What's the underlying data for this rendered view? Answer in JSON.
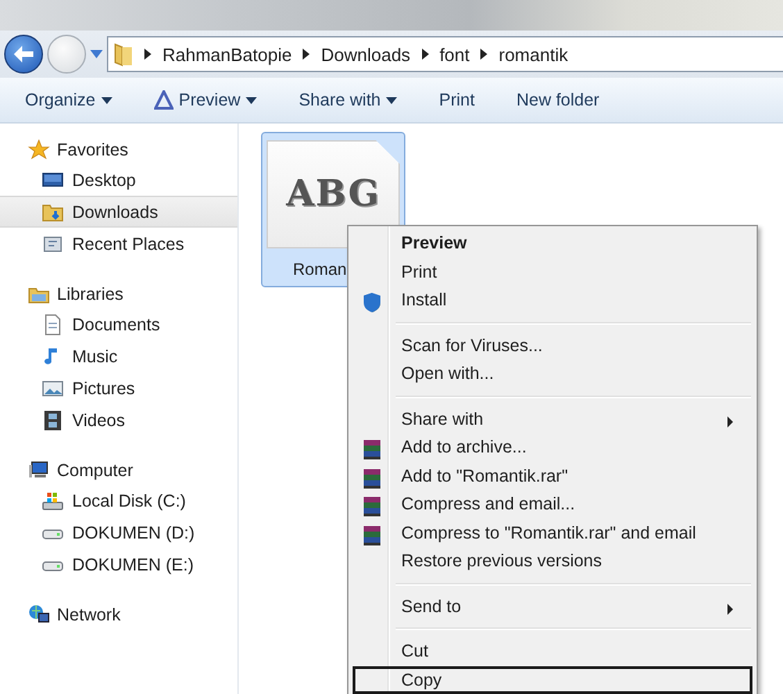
{
  "address_bar": {
    "path": [
      "RahmanBatopie",
      "Downloads",
      "font",
      "romantik"
    ]
  },
  "toolbar": [
    {
      "label": "Organize",
      "dropdown": true,
      "kind": "plain"
    },
    {
      "label": "Preview",
      "dropdown": true,
      "kind": "preview"
    },
    {
      "label": "Share with",
      "dropdown": true,
      "kind": "plain"
    },
    {
      "label": "Print",
      "dropdown": false,
      "kind": "plain"
    },
    {
      "label": "New folder",
      "dropdown": false,
      "kind": "plain"
    }
  ],
  "sidebar": {
    "groups": [
      {
        "label": "Favorites",
        "kind": "star",
        "items": [
          {
            "label": "Desktop",
            "kind": "desktop",
            "selected": false
          },
          {
            "label": "Downloads",
            "kind": "downloads",
            "selected": true
          },
          {
            "label": "Recent Places",
            "kind": "recent",
            "selected": false
          }
        ]
      },
      {
        "label": "Libraries",
        "kind": "libraries",
        "items": [
          {
            "label": "Documents",
            "kind": "document",
            "selected": false
          },
          {
            "label": "Music",
            "kind": "music",
            "selected": false
          },
          {
            "label": "Pictures",
            "kind": "pictures",
            "selected": false
          },
          {
            "label": "Videos",
            "kind": "videos",
            "selected": false
          }
        ]
      },
      {
        "label": "Computer",
        "kind": "computer",
        "items": [
          {
            "label": "Local Disk (C:)",
            "kind": "system-disk",
            "selected": false
          },
          {
            "label": "DOKUMEN (D:)",
            "kind": "drive",
            "selected": false
          },
          {
            "label": "DOKUMEN (E:)",
            "kind": "drive",
            "selected": false
          }
        ]
      },
      {
        "label": "Network",
        "kind": "network"
      }
    ]
  },
  "files": [
    {
      "name": "Roman",
      "thumbnail_text": "ABG",
      "selected": true
    }
  ],
  "context_menu": {
    "groups": [
      [
        {
          "label": "Preview",
          "kind": "plain",
          "default": true,
          "submenu": false,
          "focused": false
        },
        {
          "label": "Print",
          "kind": "plain",
          "default": false,
          "submenu": false,
          "focused": false
        },
        {
          "label": "Install",
          "kind": "shield",
          "default": false,
          "submenu": false,
          "focused": false
        }
      ],
      [
        {
          "label": "Scan for Viruses...",
          "kind": "plain",
          "default": false,
          "submenu": false,
          "focused": false
        },
        {
          "label": "Open with...",
          "kind": "plain",
          "default": false,
          "submenu": false,
          "focused": false
        }
      ],
      [
        {
          "label": "Share with",
          "kind": "plain",
          "default": false,
          "submenu": true,
          "focused": false
        },
        {
          "label": "Add to archive...",
          "kind": "archive",
          "default": false,
          "submenu": false,
          "focused": false
        },
        {
          "label": "Add to \"Romantik.rar\"",
          "kind": "archive",
          "default": false,
          "submenu": false,
          "focused": false
        },
        {
          "label": "Compress and email...",
          "kind": "archive",
          "default": false,
          "submenu": false,
          "focused": false
        },
        {
          "label": "Compress to \"Romantik.rar\" and email",
          "kind": "archive",
          "default": false,
          "submenu": false,
          "focused": false
        },
        {
          "label": "Restore previous versions",
          "kind": "plain",
          "default": false,
          "submenu": false,
          "focused": false
        }
      ],
      [
        {
          "label": "Send to",
          "kind": "plain",
          "default": false,
          "submenu": true,
          "focused": false
        }
      ],
      [
        {
          "label": "Cut",
          "kind": "plain",
          "default": false,
          "submenu": false,
          "focused": false
        },
        {
          "label": "Copy",
          "kind": "plain",
          "default": false,
          "submenu": false,
          "focused": true
        }
      ]
    ]
  }
}
